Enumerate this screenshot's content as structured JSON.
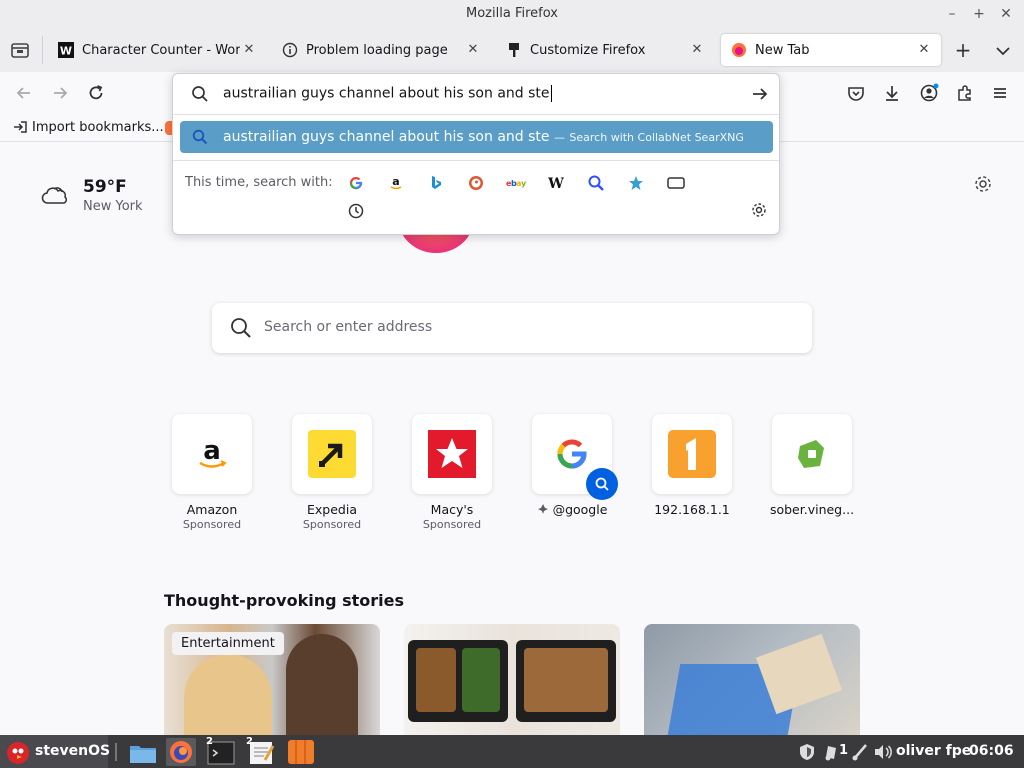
{
  "window": {
    "title": "Mozilla Firefox"
  },
  "tabs": [
    {
      "label": "Character Counter - WordCo",
      "icon": "wordcounter-icon"
    },
    {
      "label": "Problem loading page",
      "icon": "info-icon"
    },
    {
      "label": "Customize Firefox",
      "icon": "brush-icon"
    },
    {
      "label": "New Tab",
      "icon": "firefox-icon",
      "active": true
    }
  ],
  "bookmarks": {
    "import_label": "Import bookmarks..."
  },
  "urlbar": {
    "value": "austrailian guys channel about his son and ste",
    "suggestion": {
      "text": "austrailian guys channel about his son and ste",
      "separator": "—",
      "action": "Search with CollabNet SearXNG"
    },
    "oneoff_label": "This time, search with:",
    "engines": [
      "google",
      "amazon",
      "bing",
      "duckduckgo",
      "ebay",
      "wikipedia",
      "searxng",
      "bookmarks",
      "tabs",
      "history"
    ]
  },
  "weather": {
    "temp": "59°F",
    "city": "New York"
  },
  "search": {
    "placeholder": "Search or enter address"
  },
  "top_sites": [
    {
      "name": "Amazon",
      "sponsored": "Sponsored"
    },
    {
      "name": "Expedia",
      "sponsored": "Sponsored"
    },
    {
      "name": "Macy's",
      "sponsored": "Sponsored"
    },
    {
      "name": "@google",
      "sponsored": ""
    },
    {
      "name": "192.168.1.1",
      "sponsored": ""
    },
    {
      "name": "sober.vineg...",
      "sponsored": ""
    }
  ],
  "stories": {
    "title": "Thought-provoking stories",
    "cards": [
      {
        "badge": "Entertainment"
      },
      {
        "badge": ""
      },
      {
        "badge": ""
      }
    ]
  },
  "taskbar": {
    "start_label": "stevenOS",
    "terminal_count": "2",
    "editor_count": "2",
    "notif_count": "1",
    "user": "oliver fpe",
    "clock": "06:06"
  },
  "colors": {
    "accent": "#0061e0",
    "suggestion_bg": "#5a9ec8",
    "chrome_bg": "#ededf0",
    "taskbar_bg": "#3a3a3d"
  }
}
